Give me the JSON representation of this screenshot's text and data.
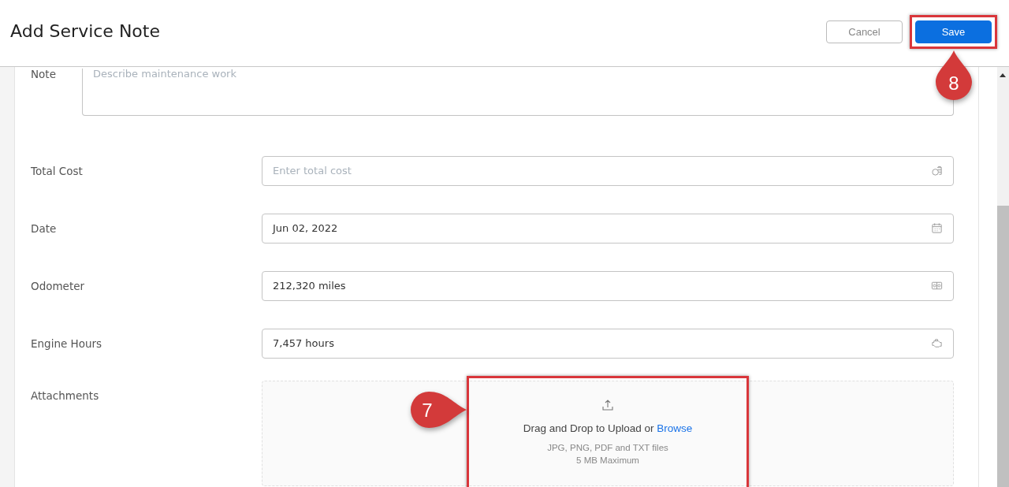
{
  "header": {
    "title": "Add Service Note",
    "buttons": [
      {
        "label": "Cancel",
        "kind": "secondary"
      },
      {
        "label": "Save",
        "kind": "primary",
        "callout": "8"
      }
    ]
  },
  "fields": [
    {
      "label": "Note",
      "kind": "textarea",
      "placeholder": "Describe maintenance work"
    },
    {
      "label": "Total Cost",
      "kind": "money",
      "placeholder": "Enter total cost"
    },
    {
      "label": "Date",
      "kind": "date",
      "value": "Jun 02, 2022"
    },
    {
      "label": "Odometer",
      "kind": "odometer",
      "value": "212,320 miles"
    },
    {
      "label": "Engine Hours",
      "kind": "engine",
      "value": "7,457 hours"
    }
  ],
  "attachments": {
    "label": "Attachments",
    "prompt": "Drag and Drop to Upload or",
    "link": "Browse",
    "types": "JPG, PNG, PDF and TXT files",
    "limit": "5 MB Maximum",
    "callout": "7"
  }
}
